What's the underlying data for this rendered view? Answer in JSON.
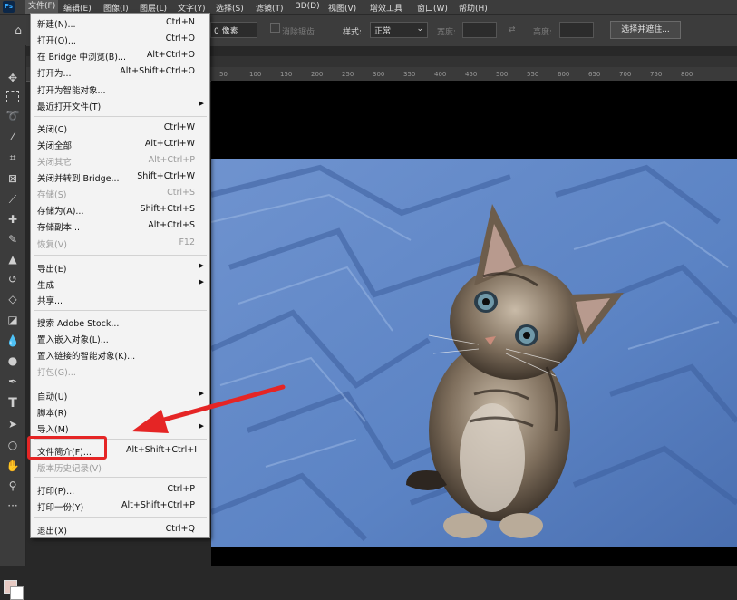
{
  "menubar": {
    "app_icon": "Ps",
    "items": [
      "文件(F)",
      "编辑(E)",
      "图像(I)",
      "图层(L)",
      "文字(Y)",
      "选择(S)",
      "滤镜(T)",
      "3D(D)",
      "视图(V)",
      "增效工具",
      "窗口(W)",
      "帮助(H)"
    ]
  },
  "options": {
    "feather_value": "0 像素",
    "antialias": "消除锯齿",
    "style_label": "样式:",
    "style_value": "正常",
    "width_label": "宽度:",
    "height_label": "高度:",
    "select_mask_button": "选择并遮住..."
  },
  "ruler": {
    "ticks": [
      "50",
      "100",
      "150",
      "200",
      "250",
      "300",
      "350",
      "400",
      "450",
      "500",
      "550",
      "600",
      "650",
      "700",
      "750",
      "800"
    ]
  },
  "file_menu": {
    "groups": [
      [
        {
          "label": "新建(N)...",
          "shortcut": "Ctrl+N"
        },
        {
          "label": "打开(O)...",
          "shortcut": "Ctrl+O"
        },
        {
          "label": "在 Bridge 中浏览(B)...",
          "shortcut": "Alt+Ctrl+O"
        },
        {
          "label": "打开为...",
          "shortcut": "Alt+Shift+Ctrl+O"
        },
        {
          "label": "打开为智能对象...",
          "shortcut": ""
        },
        {
          "label": "最近打开文件(T)",
          "shortcut": "",
          "submenu": true
        }
      ],
      [
        {
          "label": "关闭(C)",
          "shortcut": "Ctrl+W"
        },
        {
          "label": "关闭全部",
          "shortcut": "Alt+Ctrl+W"
        },
        {
          "label": "关闭其它",
          "shortcut": "Alt+Ctrl+P",
          "disabled": true
        },
        {
          "label": "关闭并转到 Bridge...",
          "shortcut": "Shift+Ctrl+W"
        },
        {
          "label": "存储(S)",
          "shortcut": "Ctrl+S",
          "disabled": true
        },
        {
          "label": "存储为(A)...",
          "shortcut": "Shift+Ctrl+S"
        },
        {
          "label": "存储副本...",
          "shortcut": "Alt+Ctrl+S"
        },
        {
          "label": "恢复(V)",
          "shortcut": "F12",
          "disabled": true
        }
      ],
      [
        {
          "label": "导出(E)",
          "shortcut": "",
          "submenu": true
        },
        {
          "label": "生成",
          "shortcut": "",
          "submenu": true
        },
        {
          "label": "共享...",
          "shortcut": ""
        }
      ],
      [
        {
          "label": "搜索 Adobe Stock...",
          "shortcut": ""
        },
        {
          "label": "置入嵌入对象(L)...",
          "shortcut": ""
        },
        {
          "label": "置入链接的智能对象(K)...",
          "shortcut": ""
        },
        {
          "label": "打包(G)...",
          "shortcut": "",
          "disabled": true
        }
      ],
      [
        {
          "label": "自动(U)",
          "shortcut": "",
          "submenu": true
        },
        {
          "label": "脚本(R)",
          "shortcut": "",
          "submenu": true
        },
        {
          "label": "导入(M)",
          "shortcut": "",
          "submenu": true
        }
      ],
      [
        {
          "label": "文件简介(F)...",
          "shortcut": "Alt+Shift+Ctrl+I"
        },
        {
          "label": "版本历史记录(V)",
          "shortcut": "",
          "disabled": true
        }
      ],
      [
        {
          "label": "打印(P)...",
          "shortcut": "Ctrl+P"
        },
        {
          "label": "打印一份(Y)",
          "shortcut": "Alt+Shift+Ctrl+P"
        }
      ],
      [
        {
          "label": "退出(X)",
          "shortcut": "Ctrl+Q"
        }
      ]
    ]
  },
  "annotation": {
    "highlight_color": "#e52525"
  },
  "tool_icons": [
    "move-icon",
    "marquee-icon",
    "lasso-icon",
    "magic-wand-icon",
    "crop-icon",
    "frame-icon",
    "eyedropper-icon",
    "healing-icon",
    "brush-icon",
    "stamp-icon",
    "history-brush-icon",
    "eraser-icon",
    "gradient-icon",
    "blur-icon",
    "dodge-icon",
    "pen-icon",
    "type-icon",
    "path-select-icon",
    "shape-icon",
    "hand-icon",
    "zoom-icon",
    "more-icon"
  ]
}
